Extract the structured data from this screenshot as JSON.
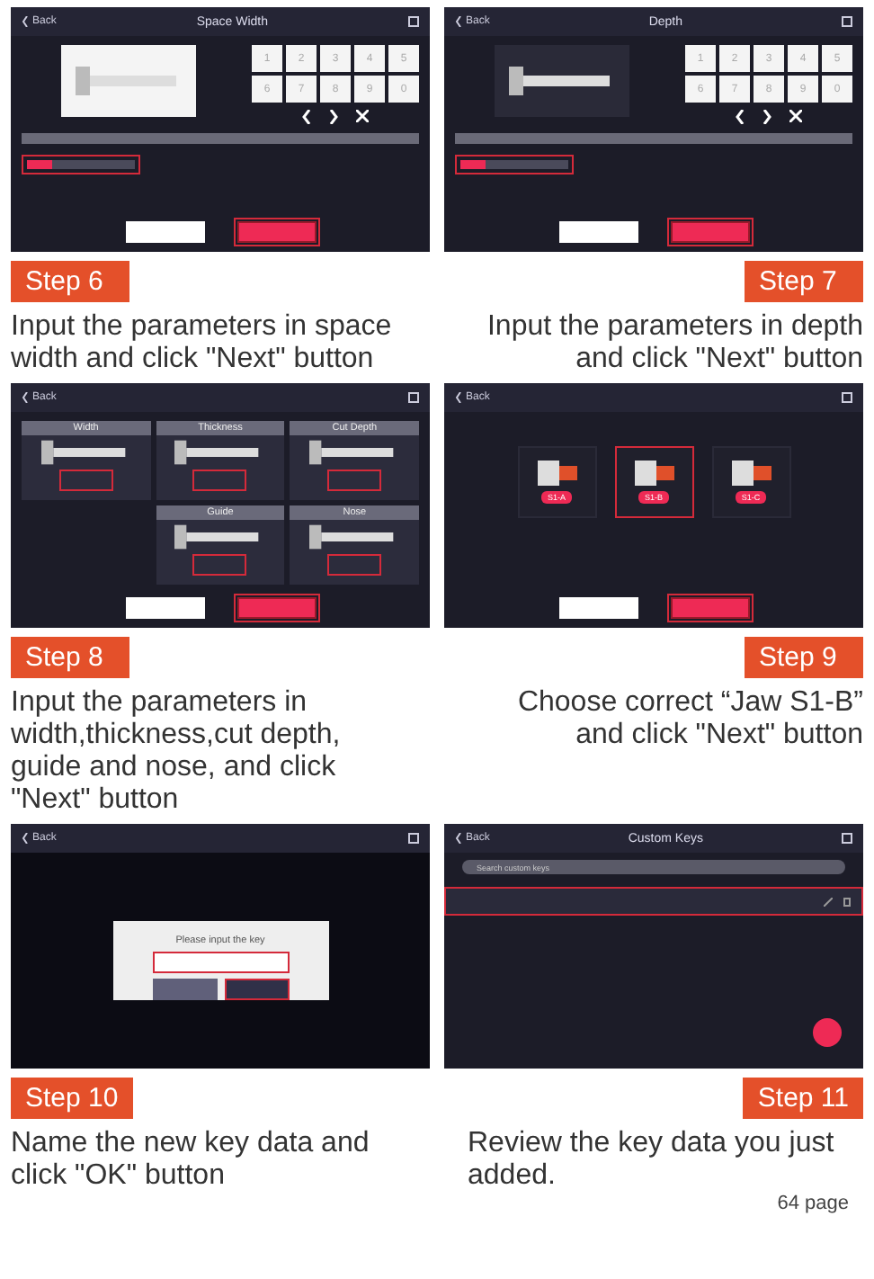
{
  "panels": [
    {
      "step": "Step 6",
      "instruction": "Input the parameters in space width and click \"Next\" button",
      "screen": {
        "kind": "keypad",
        "back": "Back",
        "title": "Space Width",
        "keys": [
          "1",
          "2",
          "3",
          "4",
          "5",
          "6",
          "7",
          "8",
          "9",
          "0"
        ]
      }
    },
    {
      "step": "Step 7",
      "instruction": "Input the parameters in depth and click \"Next\" button",
      "screen": {
        "kind": "keypad",
        "back": "Back",
        "title": "Depth",
        "keys": [
          "1",
          "2",
          "3",
          "4",
          "5",
          "6",
          "7",
          "8",
          "9",
          "0"
        ]
      }
    },
    {
      "step": "Step 8",
      "instruction": "Input the parameters in width,thickness,cut depth, guide and nose, and click \"Next\" button",
      "screen": {
        "kind": "cards",
        "back": "Back",
        "cards": [
          "Width",
          "Thickness",
          "Cut Depth",
          "Guide",
          "Nose"
        ]
      }
    },
    {
      "step": "Step 9",
      "instruction": "Choose correct “Jaw S1-B” and click \"Next\" button",
      "screen": {
        "kind": "jaws",
        "back": "Back",
        "jaws": [
          {
            "label": "S1-A",
            "selected": false
          },
          {
            "label": "S1-B",
            "selected": true
          },
          {
            "label": "S1-C",
            "selected": false
          }
        ]
      }
    },
    {
      "step": "Step 10",
      "instruction": "Name the new key data and click \"OK\" button",
      "screen": {
        "kind": "dialog",
        "back": "Back",
        "prompt": "Please input the key"
      }
    },
    {
      "step": "Step 11",
      "instruction": "Review the key data you just added.",
      "screen": {
        "kind": "list",
        "back": "Back",
        "title": "Custom Keys",
        "search": {
          "placeholder": "Search custom keys"
        }
      }
    }
  ],
  "page_number": "64 page"
}
